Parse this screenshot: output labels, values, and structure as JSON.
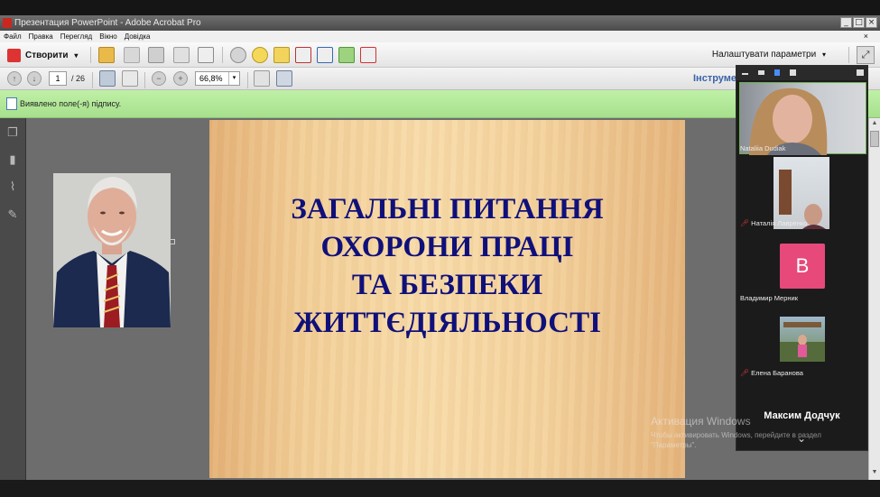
{
  "window": {
    "title": "Презентация PowerPoint - Adobe Acrobat Pro",
    "buttons": [
      "_",
      "□",
      "×"
    ]
  },
  "menu": {
    "items": [
      "Файл",
      "Правка",
      "Перегляд",
      "Вікно",
      "Довідка"
    ],
    "close": "×"
  },
  "toolbar": {
    "create_label": "Створити",
    "create_arrow": "▾",
    "settings_label": "Налаштувати параметри",
    "settings_arrow": "▾"
  },
  "nav": {
    "page_current": "1",
    "page_total": "/ 26",
    "zoom_value": "66,8%",
    "zoom_arrow": "▾",
    "tools_label": "Інструме"
  },
  "signature_bar": {
    "text": "Виявлено поле(-я) підпису."
  },
  "slide": {
    "title_lines": [
      "ЗАГАЛЬНІ ПИТАННЯ",
      "ОХОРОНИ ПРАЦІ",
      "ТА БЕЗПЕКИ",
      "ЖИТТЄДІЯЛЬНОСТІ"
    ]
  },
  "participants": [
    {
      "name": "Nataliia Dudiak",
      "muted": false
    },
    {
      "name": "Наталія Лавренко",
      "muted": true
    },
    {
      "name": "Владимир Мерник",
      "muted": false,
      "avatar_letter": "В"
    },
    {
      "name": "Елена Баранова",
      "muted": true
    }
  ],
  "active_speaker": "Максим Додчук",
  "panel_chevron": "⌄",
  "watermark": {
    "line1": "Активация Windows",
    "line2": "Чтобы активировать Windows, перейдите в раздел \"Параметры\"."
  },
  "colors": {
    "slide_title": "#10107a",
    "signature_bar": "#b3e89a",
    "avatar_b": "#e6497a",
    "tools_link": "#3b63a8"
  },
  "icons": {
    "left_nav": [
      "pages-icon",
      "bookmark-icon",
      "attachment-icon",
      "signature-icon"
    ],
    "toolbar": [
      "open-folder-icon",
      "save-icon",
      "print-icon",
      "edit-icon",
      "email-icon",
      "settings-icon",
      "comment-icon",
      "highlight-icon",
      "secure-icon",
      "sign-icon",
      "export-icon",
      "review-icon"
    ]
  }
}
